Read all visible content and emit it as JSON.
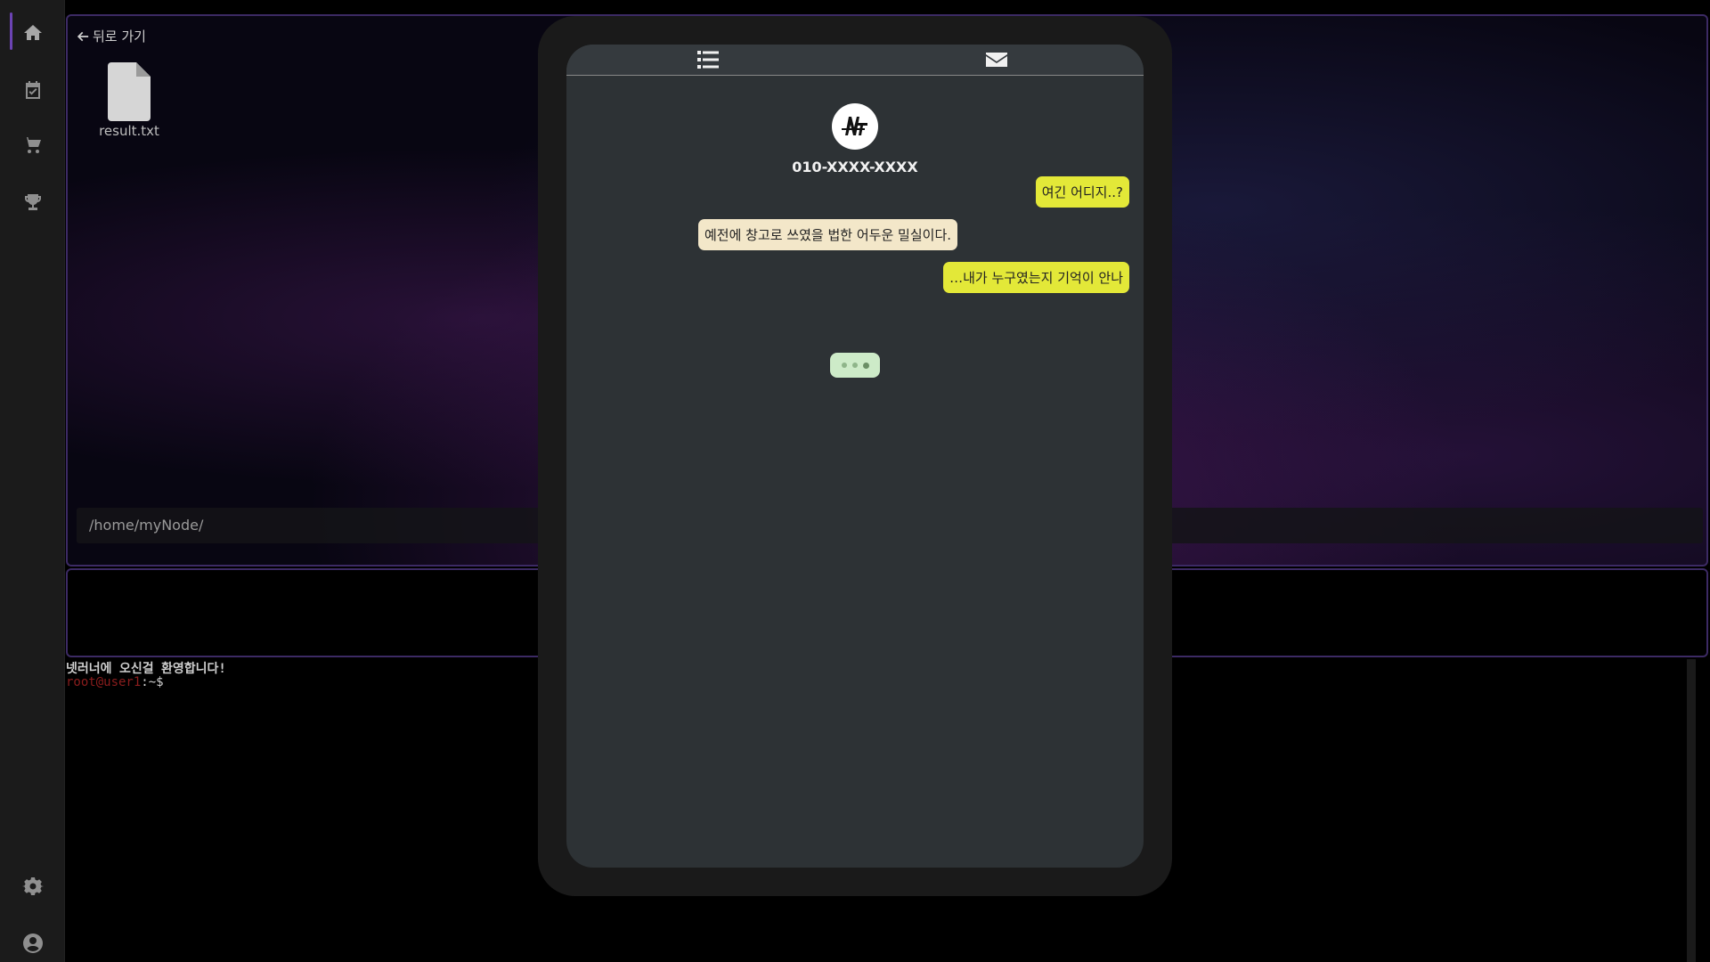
{
  "sidebar": {
    "icons": [
      "home-icon",
      "calendar-check-icon",
      "cart-icon",
      "trophy-icon",
      "gear-icon",
      "user-circle-icon"
    ]
  },
  "desktop": {
    "back_label": "뒤로 가기",
    "file_name": "result.txt",
    "path": "/home/myNode/"
  },
  "terminal": {
    "welcome": "넷러너에 오신걸 환영합니다!",
    "user": "root@user1",
    "suffix": ":~$"
  },
  "phone": {
    "tabs": [
      "list-icon",
      "envelope-icon"
    ],
    "contact_number": "010-XXXX-XXXX",
    "messages": [
      {
        "from": "me",
        "text": "여긴 어디지..?"
      },
      {
        "from": "other",
        "text": "예전에 창고로 쓰였을 법한 어두운 밀실이다."
      },
      {
        "from": "me",
        "text": "…내가 누구였는지 기억이 안나"
      }
    ]
  },
  "colors": {
    "accent": "#6b43b3",
    "bubble_me": "#e3e838",
    "bubble_other": "#f3e7c9",
    "typing": "#cdebc8",
    "phone_screen": "#2d3235"
  }
}
